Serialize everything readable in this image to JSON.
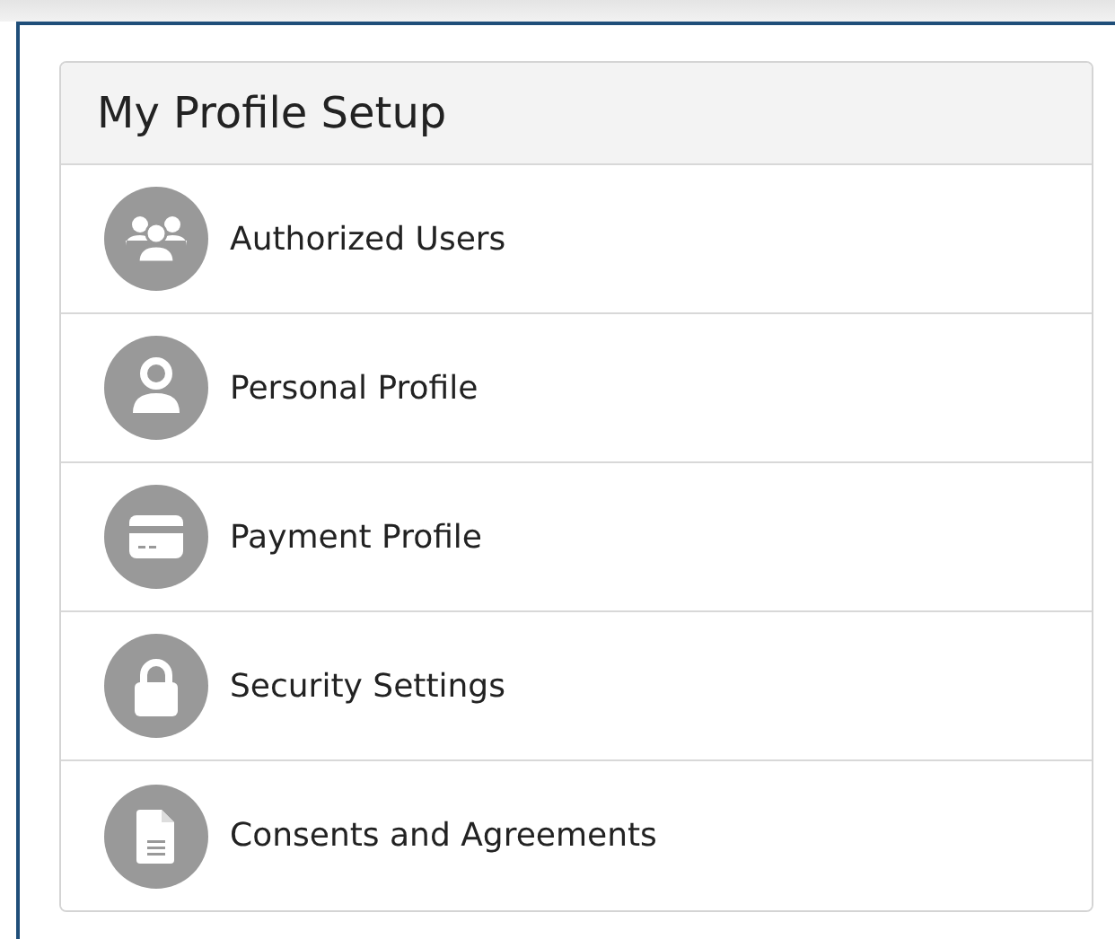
{
  "panel": {
    "title": "My Profile Setup",
    "items": [
      {
        "label": "Authorized Users",
        "kind": "users"
      },
      {
        "label": "Personal Profile",
        "kind": "user"
      },
      {
        "label": "Payment Profile",
        "kind": "card"
      },
      {
        "label": "Security Settings",
        "kind": "lock"
      },
      {
        "label": "Consents and Agreements",
        "kind": "document"
      }
    ]
  }
}
